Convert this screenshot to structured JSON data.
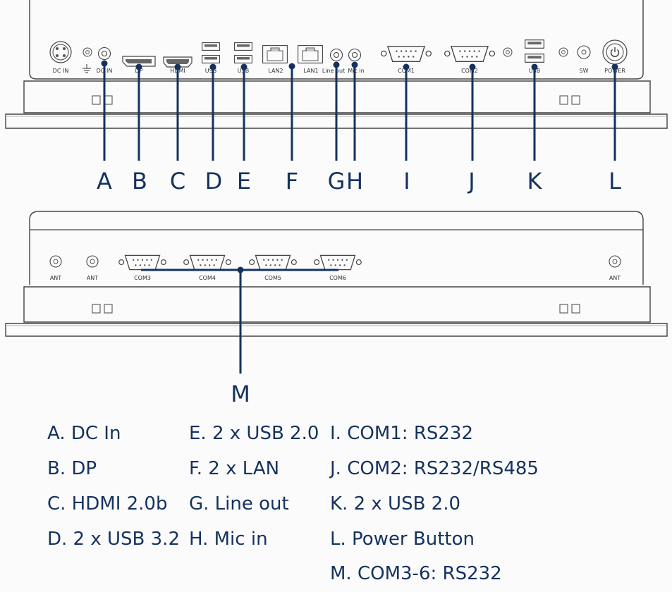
{
  "top_panel": {
    "port_labels": {
      "dc_in": "DC IN",
      "dc_in_jack": "DC IN",
      "dp": "DP",
      "hdmi": "HDMI",
      "usb_1": "USB",
      "usb_2": "USB",
      "lan2": "LAN2",
      "lan1": "LAN1",
      "line_out": "Line out",
      "mic_in": "Mic in",
      "com1": "COM1",
      "com2": "COM2",
      "usb_3": "USB",
      "sw": "SW",
      "power": "POWER"
    },
    "callouts": [
      "A",
      "B",
      "C",
      "D",
      "E",
      "F",
      "G",
      "H",
      "I",
      "J",
      "K",
      "L"
    ]
  },
  "bottom_panel": {
    "port_labels": {
      "ant_1": "ANT",
      "ant_2": "ANT",
      "com3": "COM3",
      "com4": "COM4",
      "com5": "COM5",
      "com6": "COM6",
      "ant_3": "ANT"
    },
    "callout": "M"
  },
  "legend": {
    "col1": [
      "A. DC In",
      "B. DP",
      "C. HDMI 2.0b",
      "D. 2 x USB 3.2"
    ],
    "col2": [
      "E. 2 x USB 2.0",
      "F. 2 x LAN",
      "G. Line out",
      "H. Mic in"
    ],
    "col3": [
      "I. COM1: RS232",
      "J. COM2: RS232/RS485",
      "K. 2 x USB 2.0",
      "L. Power Button",
      "M. COM3-6: RS232"
    ]
  },
  "colors": {
    "callout": "#15325e",
    "panel_outline": "#444444",
    "panel_fill": "#fbfbfb"
  }
}
